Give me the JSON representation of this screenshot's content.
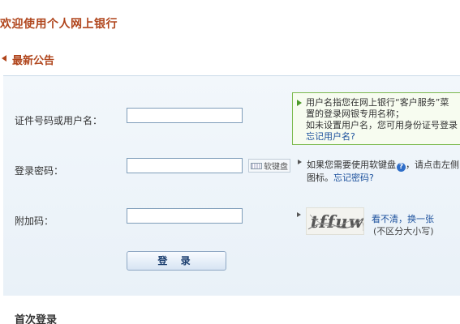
{
  "page": {
    "title": "欢迎使用个人网上银行"
  },
  "notice": {
    "title": "最新公告"
  },
  "form": {
    "username_label": "证件号码或用户名：",
    "username_value": "",
    "password_label": "登录密码：",
    "password_value": "",
    "captcha_label": "附加码：",
    "captcha_value": "",
    "login_button": "登 录"
  },
  "username_hint": {
    "line1": "用户名指您在网上银行“客户服务”菜",
    "line2": "置的登录网银专用名称；",
    "line3": "如未设置用户名，您可用身份证号登录",
    "forgot_username": "忘记用户名?"
  },
  "soft_keyboard": {
    "label": "软键盘"
  },
  "password_hint": {
    "text_before": "如果您需要使用软键盘",
    "text_after": "，请点击左侧",
    "line2_prefix": "图标。",
    "forgot_password": "忘记密码?"
  },
  "captcha": {
    "image_text": "tffuw",
    "refresh_link": "看不清，换一张",
    "case_note": "(不区分大小写)"
  },
  "first_login": {
    "title": "首次登录"
  },
  "colors": {
    "title_color": "#b0451c",
    "link_color": "#1a4f9c",
    "hint_border": "#7ab94c"
  }
}
